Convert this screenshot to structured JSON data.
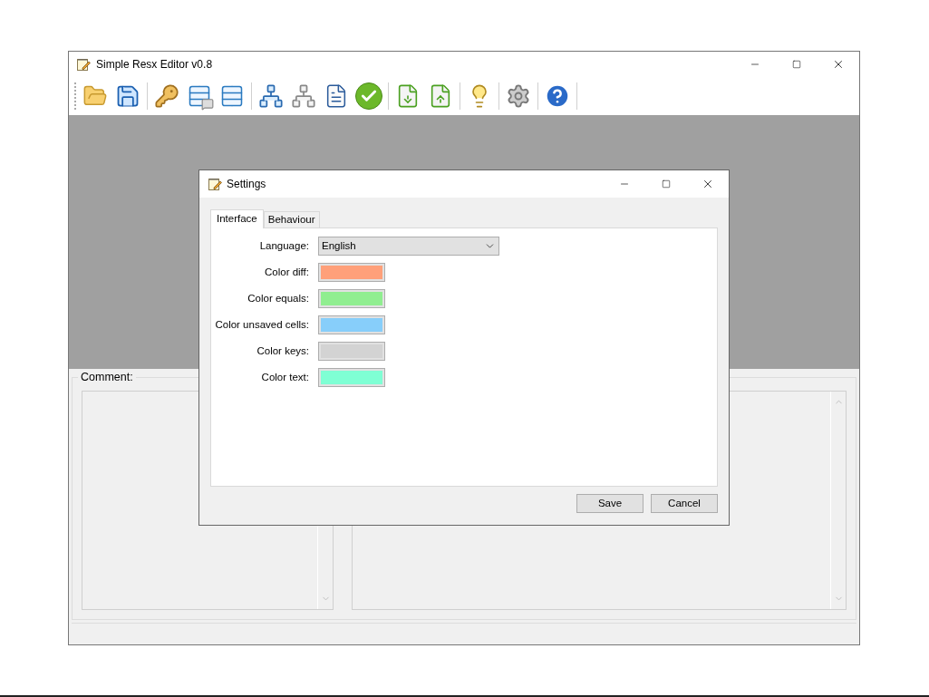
{
  "window": {
    "title": "Simple Resx Editor v0.8"
  },
  "comment_panel": {
    "label": "Comment:"
  },
  "dialog": {
    "title": "Settings",
    "tabs": [
      {
        "label": "Interface",
        "selected": true
      },
      {
        "label": "Behaviour",
        "selected": false
      }
    ],
    "language": {
      "label": "Language:",
      "value": "English"
    },
    "colors": [
      {
        "label": "Color diff:",
        "color": "#ffa07a"
      },
      {
        "label": "Color equals:",
        "color": "#90ee90"
      },
      {
        "label": "Color unsaved cells:",
        "color": "#87cefa"
      },
      {
        "label": "Color keys:",
        "color": "#d3d3d3"
      },
      {
        "label": "Color text:",
        "color": "#7fffd4"
      }
    ],
    "buttons": [
      "Save",
      "Cancel"
    ]
  }
}
